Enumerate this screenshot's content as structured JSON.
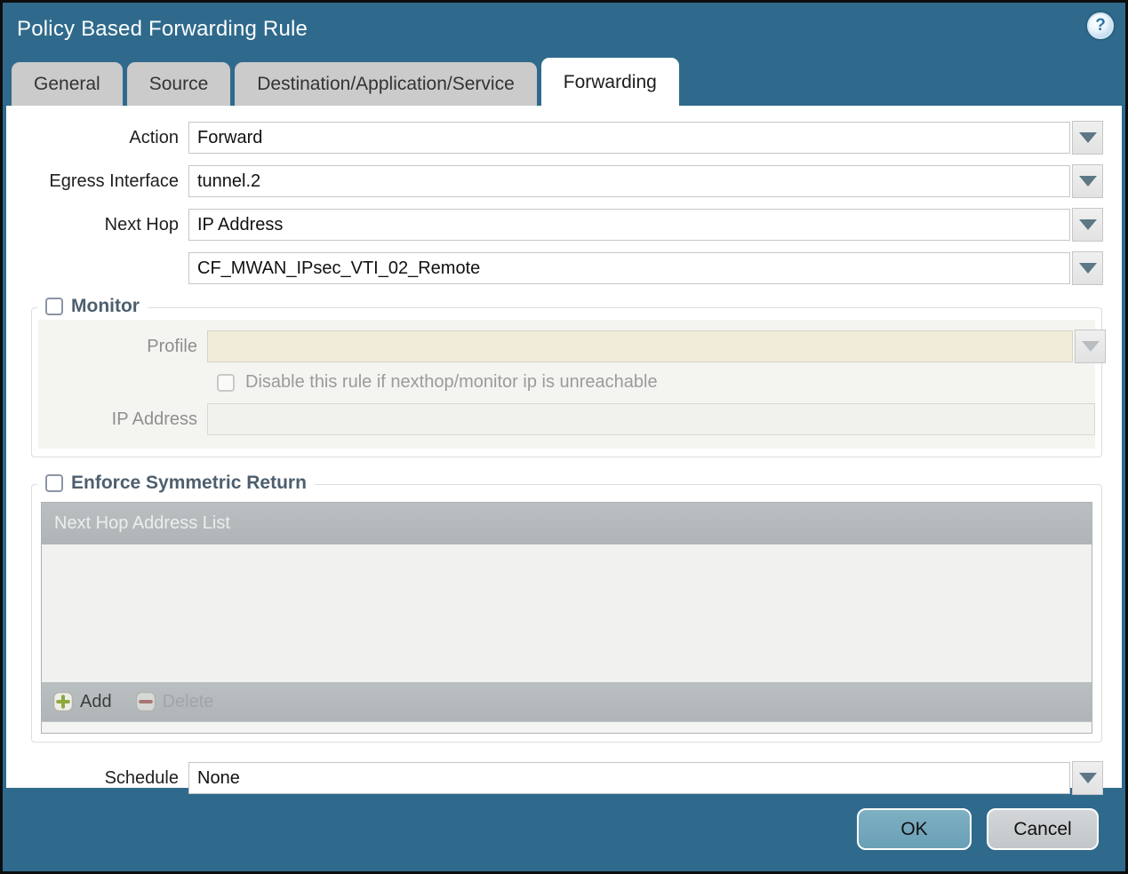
{
  "dialog": {
    "title": "Policy Based Forwarding Rule",
    "help_glyph": "?"
  },
  "tabs": [
    {
      "label": "General",
      "active": false
    },
    {
      "label": "Source",
      "active": false
    },
    {
      "label": "Destination/Application/Service",
      "active": false
    },
    {
      "label": "Forwarding",
      "active": true
    }
  ],
  "form": {
    "action": {
      "label": "Action",
      "value": "Forward"
    },
    "egress_interface": {
      "label": "Egress Interface",
      "value": "tunnel.2"
    },
    "next_hop": {
      "label": "Next Hop",
      "value": "IP Address"
    },
    "next_hop_address": {
      "value": "CF_MWAN_IPsec_VTI_02_Remote"
    },
    "schedule": {
      "label": "Schedule",
      "value": "None"
    }
  },
  "monitor": {
    "legend": "Monitor",
    "checked": false,
    "profile": {
      "label": "Profile",
      "value": ""
    },
    "disable_rule": {
      "label": "Disable this rule if nexthop/monitor ip is unreachable",
      "checked": false
    },
    "ip_address": {
      "label": "IP Address",
      "value": ""
    }
  },
  "symmetric_return": {
    "legend": "Enforce Symmetric Return",
    "checked": false,
    "table": {
      "header": "Next Hop Address List",
      "rows": []
    },
    "add_label": "Add",
    "delete_label": "Delete",
    "delete_enabled": false
  },
  "footer": {
    "ok_label": "OK",
    "cancel_label": "Cancel"
  },
  "colors": {
    "titlebar": "#2f6a8c",
    "ok_button": "#74a8bd",
    "cancel_button": "#cbcfd2",
    "beige_field": "#f1ecda",
    "table_header": "#b4babc",
    "legend_text": "#4d5f6e"
  }
}
